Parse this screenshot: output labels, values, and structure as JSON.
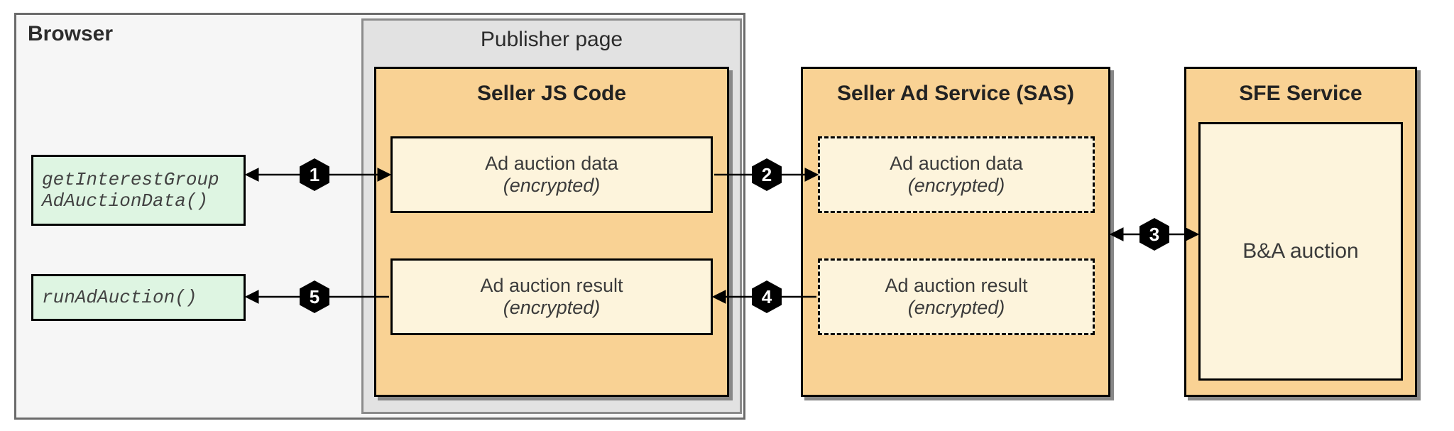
{
  "browser": {
    "title": "Browser"
  },
  "publisher": {
    "title": "Publisher page"
  },
  "sellerjs": {
    "title": "Seller JS Code"
  },
  "sas": {
    "title": "Seller Ad Service (SAS)"
  },
  "sfe": {
    "title": "SFE Service"
  },
  "api": {
    "get_ig": "getInterestGroup AdAuctionData()",
    "run": "runAdAuction()"
  },
  "boxes": {
    "ad_data": "Ad auction data",
    "ad_result": "Ad auction result",
    "encrypted": "(encrypted)",
    "ba_auction": "B&A auction"
  },
  "steps": {
    "s1": "1",
    "s2": "2",
    "s3": "3",
    "s4": "4",
    "s5": "5"
  }
}
